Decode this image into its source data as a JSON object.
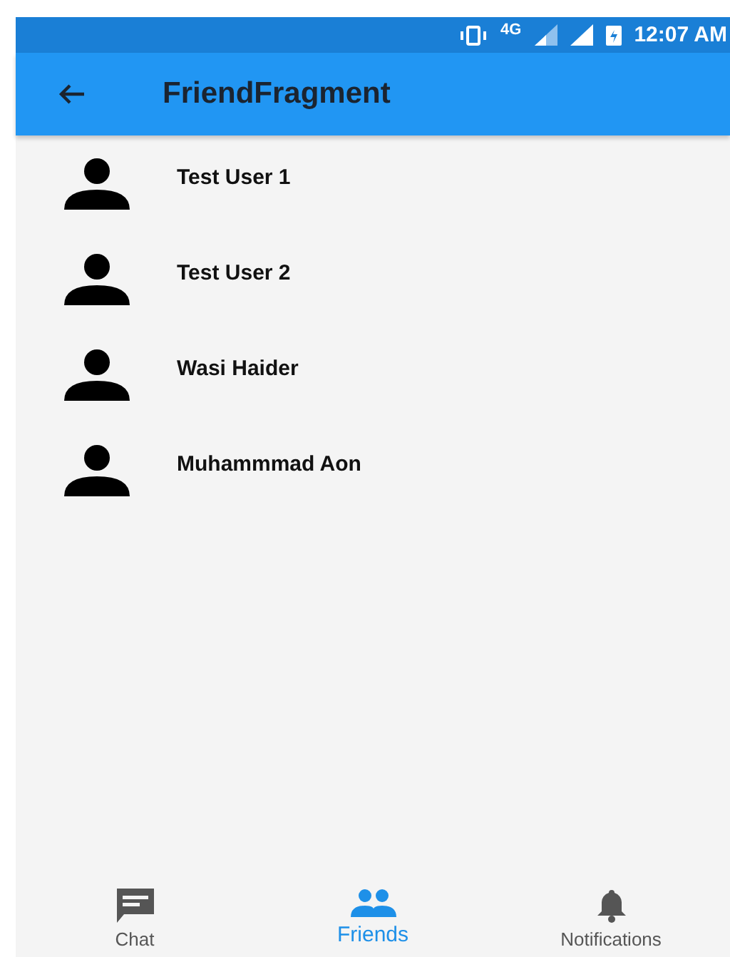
{
  "status_bar": {
    "network": "4G",
    "time": "12:07 AM"
  },
  "app_bar": {
    "title": "FriendFragment"
  },
  "friends": [
    {
      "name": "Test User 1"
    },
    {
      "name": "Test User 2"
    },
    {
      "name": "Wasi Haider"
    },
    {
      "name": "Muhammmad Aon"
    }
  ],
  "bottom_nav": [
    {
      "kind": "chat",
      "label": "Chat",
      "selected": false
    },
    {
      "kind": "friends",
      "label": "Friends",
      "selected": true
    },
    {
      "kind": "bell",
      "label": "Notifications",
      "selected": false
    }
  ]
}
